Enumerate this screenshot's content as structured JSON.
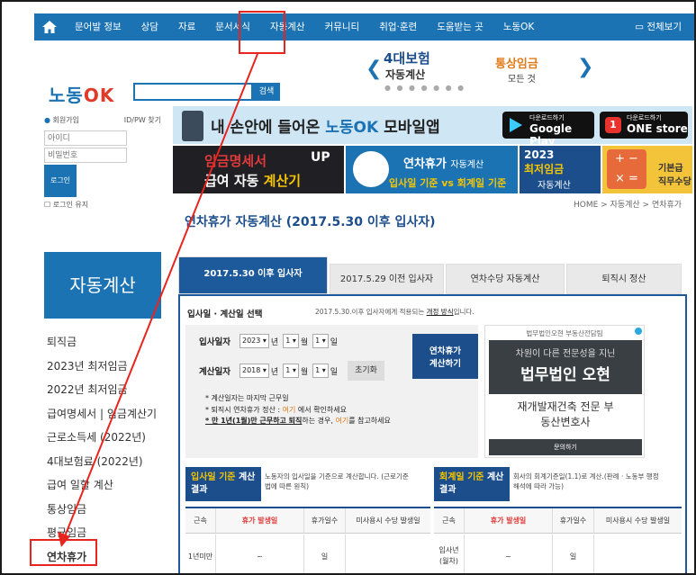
{
  "top_nav": {
    "items": [
      "문어발 정보",
      "상담",
      "자료",
      "문서서식",
      "자동계산",
      "커뮤니티",
      "취업·훈련",
      "도움받는 곳",
      "노동OK"
    ],
    "full_menu": "전체보기"
  },
  "header": {
    "logo_a": "노동",
    "logo_b": "OK",
    "search_button": "검색",
    "banner_title": "4대보험",
    "banner_sub": "자동계산",
    "tong_title": "통상임금",
    "tong_sub": "모든 것"
  },
  "login": {
    "join": "회원가입",
    "find": "ID/PW 찾기",
    "id_placeholder": "아이디",
    "pw_placeholder": "비밀번호",
    "login_button": "로그인",
    "keep": "로그인 유지"
  },
  "sidebar": {
    "heading": "자동계산",
    "items": [
      "퇴직금",
      "2023년 최저임금",
      "2022년 최저임금",
      "급여명세서 | 임금계산기",
      "근로소득세 (2022년)",
      "4대보험료 (2022년)",
      "급여 일할 계산",
      "통상임금",
      "평균임금",
      "연차휴가"
    ]
  },
  "mobile_banner": {
    "text_a": "내 손안에 들어온",
    "text_b": "노동OK",
    "text_c": "모바일앱",
    "gplay_small": "다운로드하기",
    "gplay_big": "Google Play",
    "one_small": "다운로드하기",
    "one_big": "ONE store",
    "one_badge": "1"
  },
  "banners": {
    "b1_line1": "임금명세서",
    "b1_up": "UP",
    "b1_line2a": "급여 자동",
    "b1_line2b": "계산기",
    "b2_title": "연차휴가",
    "b2_sub": "자동계산",
    "b2_line2": "입사일 기준 vs 회계일 기준",
    "b3_year": "2023",
    "b3_title": "최저임금",
    "b3_sub": "자동계산",
    "b4_calc": "+ −\n× =",
    "b4_text": "기본급\n직무수당"
  },
  "breadcrumb": "HOME > 자동계산 > 연차휴가",
  "page_title": "연차휴가 자동계산 (2017.5.30 이후 입사자)",
  "tabs": [
    "2017.5.30 이후 입사자",
    "2017.5.29 이전 입사자",
    "연차수당 자동계산",
    "퇴직시 정산"
  ],
  "form": {
    "section_title": "입사일 · 계산일 선택",
    "note_a": "2017.5.30.이후 입사자에게 적용되는",
    "note_link": "개정 방식",
    "note_b": "입니다.",
    "hire_label": "입사일자",
    "hire_year": "2023",
    "hire_month": "1",
    "hire_day": "1",
    "calc_label": "계산일자",
    "calc_year": "2018",
    "calc_month": "1",
    "calc_day": "1",
    "unit_year": "년",
    "unit_month": "월",
    "unit_day": "일",
    "reset": "초기화",
    "calc_button_1": "연차휴가",
    "calc_button_2": "계산하기",
    "note1": "* 계산일자는 마지막 근무일",
    "note2a": "* 퇴직시 연차휴가 정산 : ",
    "note2b": "여기",
    "note2c": " 에서 확인하세요",
    "note3a": "* 만 1년(1월)만 근무하고 퇴직",
    "note3b": "하는 경우, ",
    "note3c": "여기",
    "note3d": "를 참고하세요"
  },
  "ad": {
    "header": "법무법인오현 부동산전담팀",
    "line1": "차원이 다른 전문성을 지닌",
    "line2": "법무법인 오현",
    "line3": "재개발재건축 전문 부",
    "line4": "동산변호사",
    "foot": "문의하기"
  },
  "result_left": {
    "tag_a": "입사일 기준",
    "tag_b": " 계산 결과",
    "desc": "노동자의 입사일을 기준으로 계산합니다. (근로기준\n법에 따른 원칙)",
    "headers": [
      "근속",
      "휴가 발생일",
      "휴가일수",
      "미사용시 수당 발생일"
    ],
    "row_label": "1년미만",
    "row_tilde": "~",
    "row_day": "일"
  },
  "result_right": {
    "tag_a": "회계일 기준",
    "tag_b": " 계산 결과",
    "desc": "회사의 회계기준일(1.1)로 계산.(판례 · 노동부 행정\n해석에 따라 가능)",
    "headers": [
      "근속",
      "휴가 발생일",
      "휴가일수",
      "미사용시 수당 발생일"
    ],
    "row_label": "입사년\n(월차)",
    "row_tilde": "~",
    "row_day": "일"
  },
  "colors": {
    "nav_blue": "#1c73b4",
    "dark_blue": "#1c4e8c",
    "annotation_red": "#e8241e"
  }
}
